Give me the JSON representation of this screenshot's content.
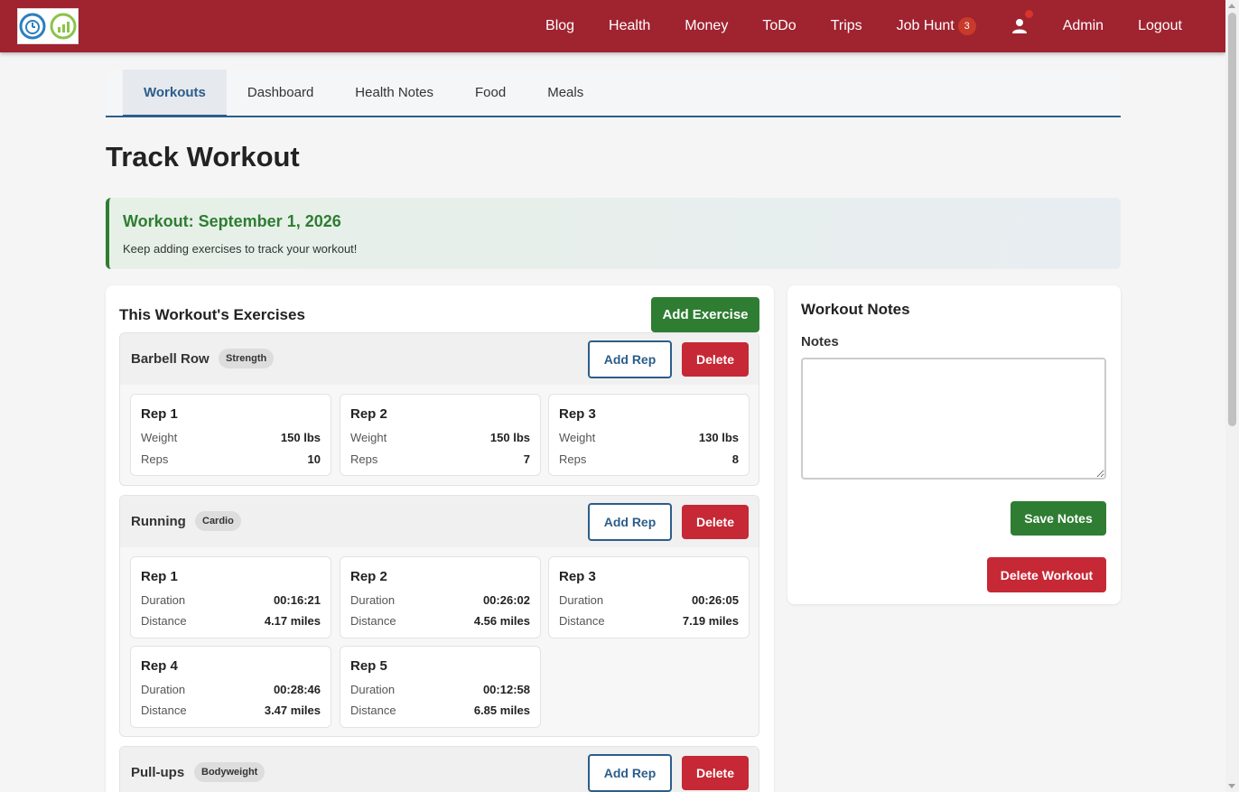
{
  "nav": {
    "links": [
      "Blog",
      "Health",
      "Money",
      "ToDo",
      "Trips"
    ],
    "job_hunt": "Job Hunt",
    "job_hunt_badge": "3",
    "admin": "Admin",
    "logout": "Logout"
  },
  "tabs": [
    "Workouts",
    "Dashboard",
    "Health Notes",
    "Food",
    "Meals"
  ],
  "active_tab": "Workouts",
  "page_title": "Track Workout",
  "banner": {
    "title": "Workout: September 1, 2026",
    "text": "Keep adding exercises to track your workout!"
  },
  "exercises_card": {
    "title": "This Workout's Exercises",
    "add_exercise": "Add Exercise",
    "add_rep": "Add Rep",
    "delete": "Delete",
    "exercises": [
      {
        "name": "Barbell Row",
        "tag": "Strength",
        "reps": [
          {
            "title": "Rep 1",
            "k1": "Weight",
            "v1": "150 lbs",
            "k2": "Reps",
            "v2": "10"
          },
          {
            "title": "Rep 2",
            "k1": "Weight",
            "v1": "150 lbs",
            "k2": "Reps",
            "v2": "7"
          },
          {
            "title": "Rep 3",
            "k1": "Weight",
            "v1": "130 lbs",
            "k2": "Reps",
            "v2": "8"
          }
        ]
      },
      {
        "name": "Running",
        "tag": "Cardio",
        "reps": [
          {
            "title": "Rep 1",
            "k1": "Duration",
            "v1": "00:16:21",
            "k2": "Distance",
            "v2": "4.17 miles"
          },
          {
            "title": "Rep 2",
            "k1": "Duration",
            "v1": "00:26:02",
            "k2": "Distance",
            "v2": "4.56 miles"
          },
          {
            "title": "Rep 3",
            "k1": "Duration",
            "v1": "00:26:05",
            "k2": "Distance",
            "v2": "7.19 miles"
          },
          {
            "title": "Rep 4",
            "k1": "Duration",
            "v1": "00:28:46",
            "k2": "Distance",
            "v2": "3.47 miles"
          },
          {
            "title": "Rep 5",
            "k1": "Duration",
            "v1": "00:12:58",
            "k2": "Distance",
            "v2": "6.85 miles"
          }
        ]
      },
      {
        "name": "Pull-ups",
        "tag": "Bodyweight",
        "reps": []
      }
    ]
  },
  "notes_card": {
    "title": "Workout Notes",
    "label": "Notes",
    "value": "",
    "save": "Save Notes",
    "delete_workout": "Delete Workout"
  },
  "colors": {
    "nav_bg": "#a02330",
    "accent_blue": "#2c5d8a",
    "green": "#2e7d32",
    "red": "#c62835"
  }
}
